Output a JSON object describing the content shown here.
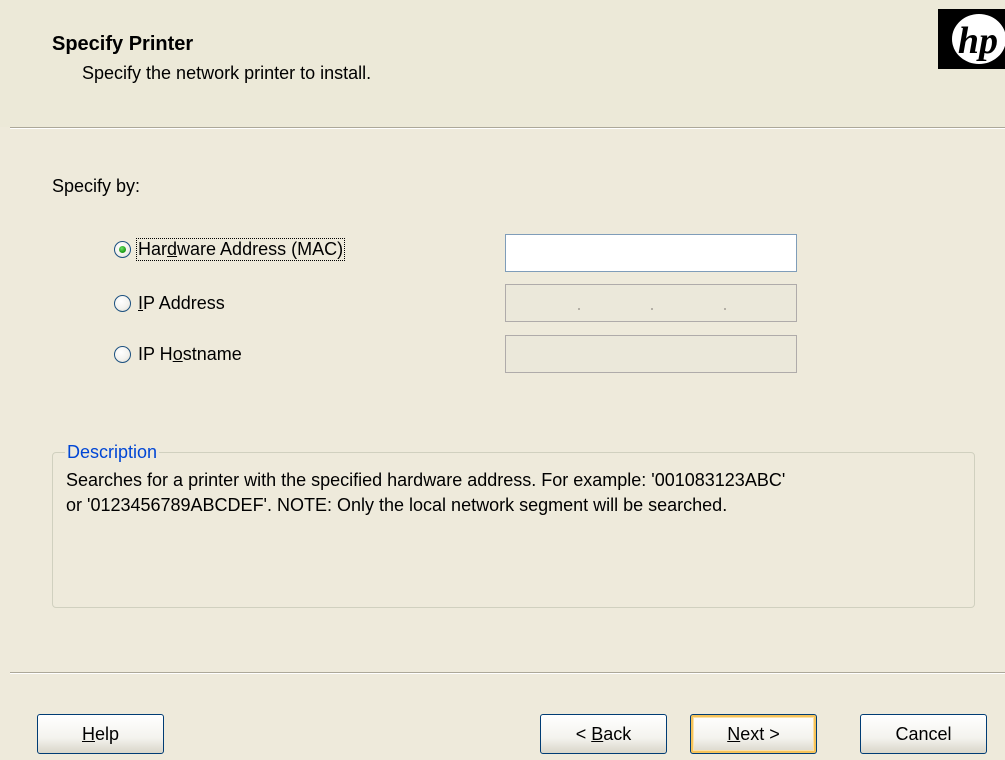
{
  "header": {
    "title": "Specify Printer",
    "subtitle": "Specify the network printer to install.",
    "logo_text": "hp"
  },
  "form": {
    "specify_label": "Specify by:",
    "options": [
      {
        "label_before": "Har",
        "label_mnemonic": "d",
        "label_after": "ware Address (MAC)",
        "checked": true
      },
      {
        "label_before": "",
        "label_mnemonic": "I",
        "label_after": "P Address",
        "checked": false
      },
      {
        "label_before": "IP H",
        "label_mnemonic": "o",
        "label_after": "stname",
        "checked": false
      }
    ],
    "mac_value": "",
    "ip_value": "",
    "hostname_value": ""
  },
  "description": {
    "legend": "Description",
    "line1": "Searches for a printer with the specified hardware address.  For example: '001083123ABC'",
    "line2": "or '0123456789ABCDEF'.  NOTE: Only the local network segment will be searched."
  },
  "buttons": {
    "help": {
      "mnemonic": "H",
      "rest": "elp"
    },
    "back": {
      "before": "< ",
      "mnemonic": "B",
      "rest": "ack"
    },
    "next": {
      "mnemonic": "N",
      "rest": "ext >"
    },
    "cancel": {
      "label": "Cancel"
    }
  },
  "colors": {
    "dialog_bg": "#eeeadb",
    "accent_blue": "#0046d5",
    "default_button_highlight": "#f5c35a",
    "radio_selected": "#21a21a"
  }
}
